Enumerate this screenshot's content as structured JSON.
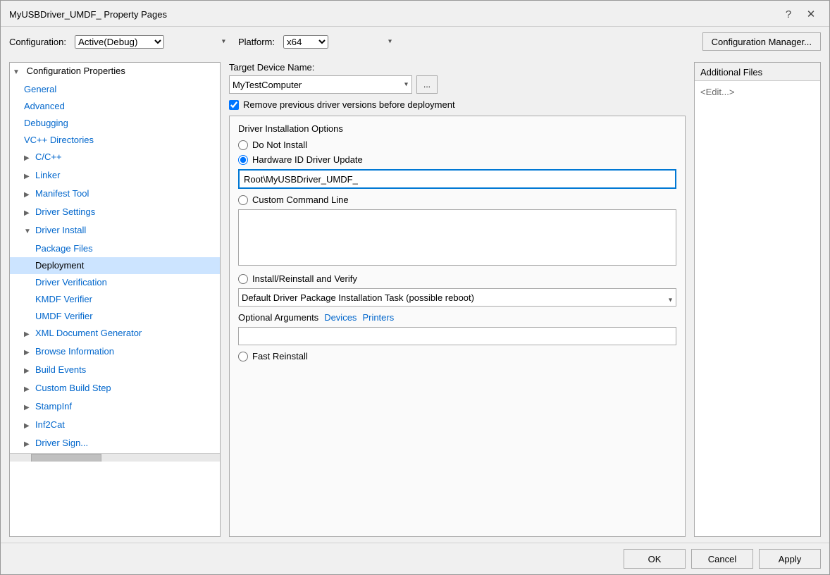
{
  "dialog": {
    "title": "MyUSBDriver_UMDF_ Property Pages",
    "help_btn": "?",
    "close_btn": "✕"
  },
  "config_bar": {
    "config_label": "Configuration:",
    "config_value": "Active(Debug)",
    "platform_label": "Platform:",
    "platform_value": "x64",
    "config_mgr_label": "Configuration Manager..."
  },
  "tree": {
    "root_label": "Configuration Properties",
    "items": [
      {
        "id": "general",
        "label": "General",
        "level": 1,
        "expandable": false
      },
      {
        "id": "advanced",
        "label": "Advanced",
        "level": 1,
        "expandable": false
      },
      {
        "id": "debugging",
        "label": "Debugging",
        "level": 1,
        "expandable": false
      },
      {
        "id": "vc-dirs",
        "label": "VC++ Directories",
        "level": 1,
        "expandable": false
      },
      {
        "id": "cpp",
        "label": "C/C++",
        "level": 1,
        "expandable": true,
        "expanded": false
      },
      {
        "id": "linker",
        "label": "Linker",
        "level": 1,
        "expandable": true,
        "expanded": false
      },
      {
        "id": "manifest-tool",
        "label": "Manifest Tool",
        "level": 1,
        "expandable": true,
        "expanded": false
      },
      {
        "id": "driver-settings",
        "label": "Driver Settings",
        "level": 1,
        "expandable": true,
        "expanded": false
      },
      {
        "id": "driver-install",
        "label": "Driver Install",
        "level": 1,
        "expandable": true,
        "expanded": true
      },
      {
        "id": "package-files",
        "label": "Package Files",
        "level": 2,
        "expandable": false
      },
      {
        "id": "deployment",
        "label": "Deployment",
        "level": 2,
        "expandable": false,
        "selected": true
      },
      {
        "id": "driver-verification",
        "label": "Driver Verification",
        "level": 2,
        "expandable": false
      },
      {
        "id": "kmdf-verifier",
        "label": "KMDF Verifier",
        "level": 2,
        "expandable": false
      },
      {
        "id": "umdf-verifier",
        "label": "UMDF Verifier",
        "level": 2,
        "expandable": false
      },
      {
        "id": "xml-doc",
        "label": "XML Document Generator",
        "level": 1,
        "expandable": true,
        "expanded": false
      },
      {
        "id": "browse-info",
        "label": "Browse Information",
        "level": 1,
        "expandable": true,
        "expanded": false
      },
      {
        "id": "build-events",
        "label": "Build Events",
        "level": 1,
        "expandable": true,
        "expanded": false
      },
      {
        "id": "custom-build",
        "label": "Custom Build Step",
        "level": 1,
        "expandable": true,
        "expanded": false
      },
      {
        "id": "stampinf",
        "label": "StampInf",
        "level": 1,
        "expandable": true,
        "expanded": false
      },
      {
        "id": "inf2cat",
        "label": "Inf2Cat",
        "level": 1,
        "expandable": true,
        "expanded": false
      },
      {
        "id": "driversign",
        "label": "Driver Sign...",
        "level": 1,
        "expandable": true,
        "expanded": false
      }
    ]
  },
  "form": {
    "target_device_label": "Target Device Name:",
    "target_device_value": "MyTestComputer",
    "browse_btn_label": "...",
    "remove_prev_label": "Remove previous driver versions before deployment",
    "driver_install_options_label": "Driver Installation Options",
    "do_not_install_label": "Do Not Install",
    "hw_id_label": "Hardware ID Driver Update",
    "hw_id_value": "Root\\MyUSBDriver_UMDF_",
    "custom_cmd_label": "Custom Command Line",
    "install_reinstall_label": "Install/Reinstall and Verify",
    "install_options": [
      "Default Driver Package Installation Task (possible reboot)"
    ],
    "optional_args_label": "Optional Arguments",
    "devices_link": "Devices",
    "printers_link": "Printers",
    "optional_args_value": "",
    "fast_reinstall_label": "Fast Reinstall",
    "additional_files_label": "Additional Files",
    "additional_files_edit": "<Edit...>"
  },
  "buttons": {
    "ok_label": "OK",
    "cancel_label": "Cancel",
    "apply_label": "Apply"
  }
}
